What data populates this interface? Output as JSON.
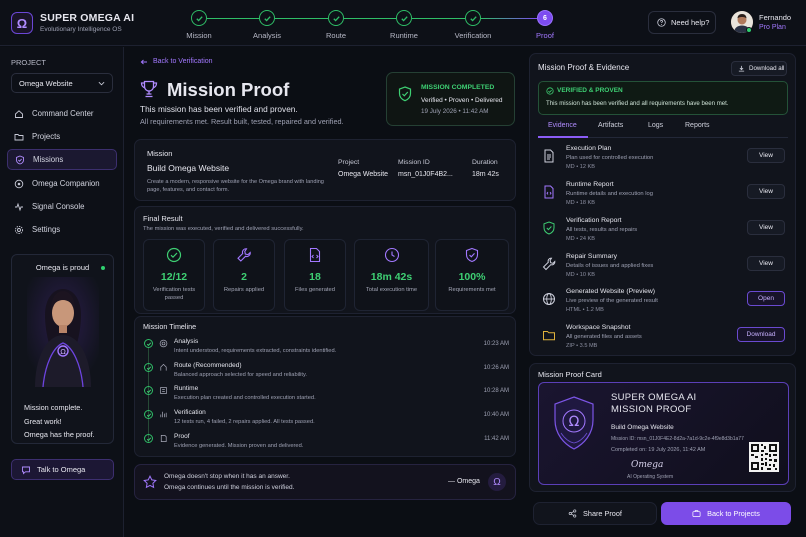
{
  "app": {
    "name": "SUPER OMEGA AI",
    "tagline": "Evolutionary Intelligence OS",
    "logo_glyph": "Ω"
  },
  "steps": [
    {
      "label": "Mission",
      "state": "done"
    },
    {
      "label": "Analysis",
      "state": "done"
    },
    {
      "label": "Route",
      "state": "done"
    },
    {
      "label": "Runtime",
      "state": "done"
    },
    {
      "label": "Verification",
      "state": "done"
    },
    {
      "label": "Proof",
      "state": "current",
      "number": "6"
    }
  ],
  "header": {
    "help_label": "Need help?",
    "user_name": "Fernando",
    "user_plan": "Pro Plan"
  },
  "sidebar": {
    "project_label": "PROJECT",
    "project_value": "Omega Website",
    "nav": [
      {
        "label": "Command Center",
        "icon": "home-icon"
      },
      {
        "label": "Projects",
        "icon": "folder-icon"
      },
      {
        "label": "Missions",
        "icon": "shield-icon",
        "active": true
      },
      {
        "label": "Omega Companion",
        "icon": "companion-icon"
      },
      {
        "label": "Signal Console",
        "icon": "signal-icon"
      },
      {
        "label": "Settings",
        "icon": "gear-icon"
      }
    ],
    "companion_status": "Omega is proud",
    "companion_lines": [
      "Mission complete.",
      "Great work!",
      "Omega has the proof."
    ],
    "talk_button": "Talk to Omega"
  },
  "main": {
    "back_link": "Back to Verification",
    "title": "Mission Proof",
    "subtitle": "This mission has been verified and proven.",
    "subtitle2": "All requirements met. Result built, tested, repaired and verified.",
    "completed": {
      "label": "MISSION COMPLETED",
      "status": "Verified • Proven • Delivered",
      "datetime": "19 July 2026 • 11:42 AM"
    },
    "mission": {
      "heading": "Mission",
      "name": "Build Omega Website",
      "description": "Create a modern, responsive website for the Omega brand with landing page, features, and contact form.",
      "project_label": "Project",
      "project_value": "Omega Website",
      "id_label": "Mission ID",
      "id_value": "msn_01J0F4B2...",
      "duration_label": "Duration",
      "duration_value": "18m 42s"
    },
    "final_result": {
      "heading": "Final Result",
      "subtitle": "The mission was executed, verified and delivered successfully.",
      "stats": [
        {
          "value": "12/12",
          "label": "Verification tests passed",
          "icon": "check-circle-icon"
        },
        {
          "value": "2",
          "label": "Repairs applied",
          "icon": "wrench-icon"
        },
        {
          "value": "18",
          "label": "Files generated",
          "icon": "file-code-icon"
        },
        {
          "value": "18m 42s",
          "label": "Total execution time",
          "icon": "clock-icon"
        },
        {
          "value": "100%",
          "label": "Requirements met",
          "icon": "shield-check-icon"
        }
      ]
    },
    "timeline": {
      "heading": "Mission Timeline",
      "items": [
        {
          "title": "Analysis",
          "desc": "Intent understood, requirements extracted, constraints identified.",
          "time": "10:23 AM"
        },
        {
          "title": "Route (Recommended)",
          "desc": "Balanced approach selected for speed and reliability.",
          "time": "10:26 AM"
        },
        {
          "title": "Runtime",
          "desc": "Execution plan created and controlled execution started.",
          "time": "10:28 AM"
        },
        {
          "title": "Verification",
          "desc": "12 tests run, 4 failed, 2 repairs applied. All tests passed.",
          "time": "10:40 AM"
        },
        {
          "title": "Proof",
          "desc": "Evidence generated. Mission proven and delivered.",
          "time": "11:42 AM"
        }
      ]
    },
    "quote": {
      "line1": "Omega doesn't stop when it has an answer.",
      "line2": "Omega continues until the mission is verified.",
      "signature": "— Omega"
    }
  },
  "right": {
    "title": "Mission Proof & Evidence",
    "download_all": "Download all",
    "verified": {
      "label": "VERIFIED & PROVEN",
      "text": "This mission has been verified and all requirements have been met."
    },
    "tabs": [
      "Evidence",
      "Artifacts",
      "Logs",
      "Reports"
    ],
    "evidence": [
      {
        "title": "Execution Plan",
        "desc": "Plan used for controlled execution",
        "meta": "MD • 12 KB",
        "action": "View",
        "icon": "document-icon"
      },
      {
        "title": "Runtime Report",
        "desc": "Runtime details and execution log",
        "meta": "MD • 18 KB",
        "action": "View",
        "icon": "code-file-icon"
      },
      {
        "title": "Verification Report",
        "desc": "All tests, results and repairs",
        "meta": "MD • 24 KB",
        "action": "View",
        "icon": "shield-check-icon"
      },
      {
        "title": "Repair Summary",
        "desc": "Details of issues and applied fixes",
        "meta": "MD • 10 KB",
        "action": "View",
        "icon": "wrench-icon"
      },
      {
        "title": "Generated Website (Preview)",
        "desc": "Live preview of the generated result",
        "meta": "HTML • 1.2 MB",
        "action": "Open",
        "icon": "globe-icon"
      },
      {
        "title": "Workspace Snapshot",
        "desc": "All generated files and assets",
        "meta": "ZIP • 3.5 MB",
        "action": "Download",
        "icon": "folder-icon"
      }
    ],
    "proof_card": {
      "heading": "Mission Proof Card",
      "brand": "SUPER OMEGA AI",
      "title": "MISSION PROOF",
      "mission": "Build Omega Website",
      "mission_id": "Mission ID:  msn_01J0F4E2-8d2a-7a1d-9c2e-4f9e8d3b1a77",
      "completed": "Completed on:  19 July 2026, 11:42 AM",
      "signature": "Omega",
      "signature_sub": "AI Operating System"
    },
    "share_button": "Share Proof",
    "back_button": "Back to Projects"
  }
}
